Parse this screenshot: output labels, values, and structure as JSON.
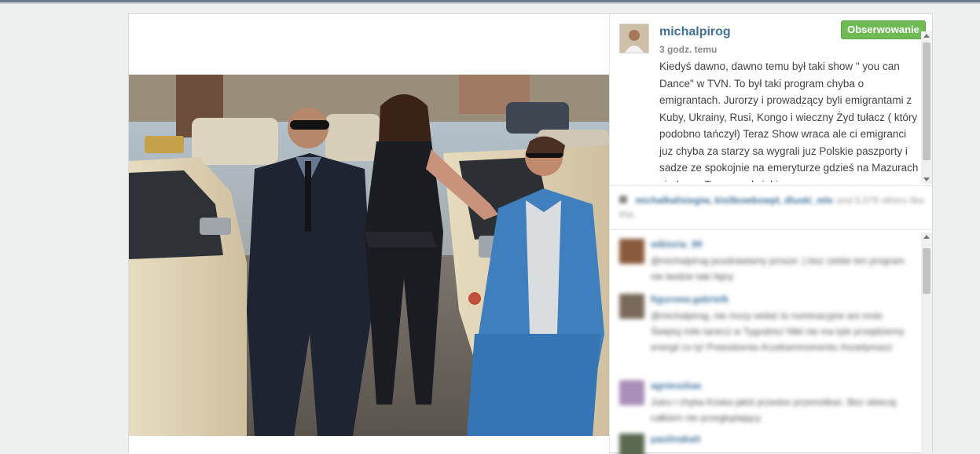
{
  "post": {
    "username": "michalpirog",
    "time": "3 godz. temu",
    "follow_label": "Obserwowanie",
    "caption": "Kiedyś dawno, dawno temu był taki show \" you can Dance\" w TVN. To był taki program chyba o emigrantach. Jurorzy i prowadzący byli emigrantami z Kuby, Ukrainy, Rusi, Kongo i wieczny Żyd tułacz ( który podobno tańczył) Teraz Show wraca ale ci emigranci juz chyba za starzy sa wygrali juz Polskie paszporty i sadze ze spokojnie na emeryturze gdzieś na Mazurach siedzą ... Trzymam kciuki za"
  },
  "likes": {
    "names": "michalkalisiegiw, kisilbowbowpl, dluski_mls",
    "rest": "and 5,079 others like this."
  },
  "comments": [
    {
      "user": "wiktoria_99",
      "text": "@michalpirog pozdrawiamy prosze :) bez ciebie ten program nie bedzie taki fajny"
    },
    {
      "user": "figurowa.gabrielk",
      "text": "@michalpirog, nie mozy widać to nominacyjne ani mnie Świętuj milo tanecz w Tygodniu! Nikt nie ma tyle przejdziemy energii co ty! Powodzenia #czekammomentu #sowtymazz"
    },
    {
      "user": "agnieszkaa",
      "text": "Jutro i chyba Koska jakiś przedze przemotkać. Bez obiecaj całkiem nie przegłupiający"
    },
    {
      "user": "paulinakatt",
      "text": ""
    }
  ],
  "colors": {
    "link": "#3f729b",
    "follow_bg": "#6fbb53"
  }
}
